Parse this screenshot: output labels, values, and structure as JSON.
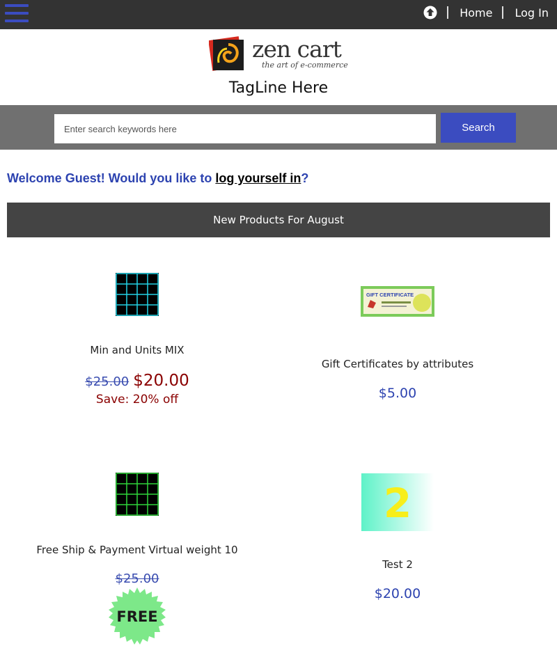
{
  "header": {
    "home_label": "Home",
    "login_label": "Log In",
    "icons": [
      "menu-icon",
      "up-arrow-icon"
    ]
  },
  "logo": {
    "word": "zen cart",
    "tagline": "the art of e-commerce"
  },
  "tagline": "TagLine Here",
  "search": {
    "placeholder": "Enter search keywords here",
    "button_label": "Search"
  },
  "welcome": {
    "prefix": "Welcome Guest! Would you like to ",
    "link": "log yourself in",
    "suffix": "?"
  },
  "section_title": "New Products For August",
  "products": [
    {
      "name": "Min and Units MIX",
      "old_price": "$25.00",
      "price": "$20.00",
      "save": "Save: 20% off"
    },
    {
      "name": "Gift Certificates by attributes",
      "price": "$5.00",
      "image_text": "GIFT CERTIFICATE"
    },
    {
      "name": "Free Ship & Payment Virtual weight 10",
      "old_price": "$25.00",
      "badge": "FREE"
    },
    {
      "name": "Test 2",
      "price": "$20.00",
      "image_text": "2"
    }
  ],
  "colors": {
    "topbar": "#333333",
    "accent": "#3b4cc0",
    "sale": "#8a0000",
    "section_bar": "#444444"
  }
}
